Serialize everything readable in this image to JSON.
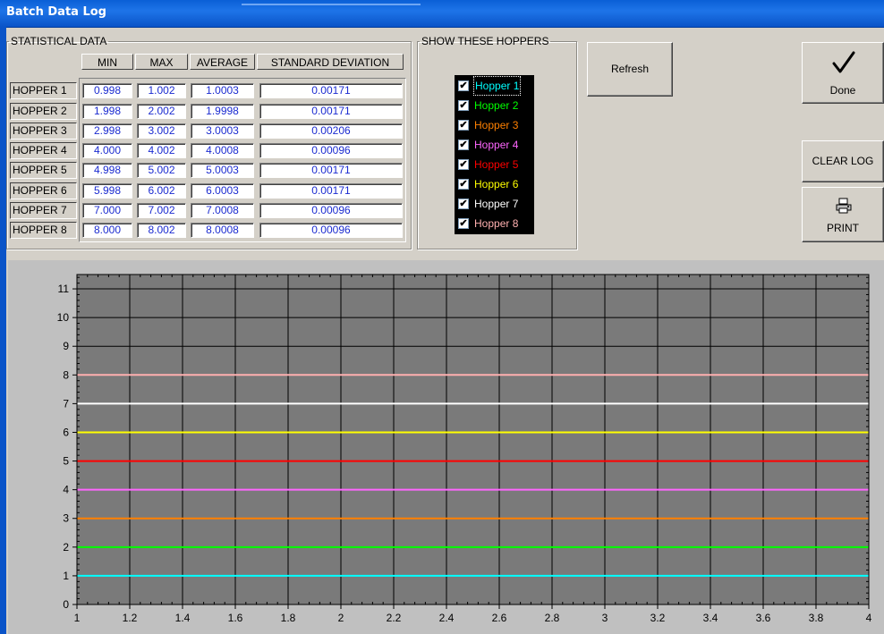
{
  "window": {
    "title": "Batch Data Log"
  },
  "stats": {
    "legend": "STATISTICAL DATA",
    "columns": [
      "MIN",
      "MAX",
      "AVERAGE",
      "STANDARD DEVIATION"
    ],
    "rows": [
      {
        "label": "HOPPER 1",
        "min": "0.998",
        "max": "1.002",
        "average": "1.0003",
        "stddev": "0.00171"
      },
      {
        "label": "HOPPER 2",
        "min": "1.998",
        "max": "2.002",
        "average": "1.9998",
        "stddev": "0.00171"
      },
      {
        "label": "HOPPER 3",
        "min": "2.998",
        "max": "3.002",
        "average": "3.0003",
        "stddev": "0.00206"
      },
      {
        "label": "HOPPER 4",
        "min": "4.000",
        "max": "4.002",
        "average": "4.0008",
        "stddev": "0.00096"
      },
      {
        "label": "HOPPER 5",
        "min": "4.998",
        "max": "5.002",
        "average": "5.0003",
        "stddev": "0.00171"
      },
      {
        "label": "HOPPER 6",
        "min": "5.998",
        "max": "6.002",
        "average": "6.0003",
        "stddev": "0.00171"
      },
      {
        "label": "HOPPER 7",
        "min": "7.000",
        "max": "7.002",
        "average": "7.0008",
        "stddev": "0.00096"
      },
      {
        "label": "HOPPER 8",
        "min": "8.000",
        "max": "8.002",
        "average": "8.0008",
        "stddev": "0.00096"
      }
    ]
  },
  "hoppers": {
    "legend": "SHOW THESE HOPPERS",
    "items": [
      {
        "label": "Hopper 1",
        "checked": true,
        "color": "#00ffff"
      },
      {
        "label": "Hopper 2",
        "checked": true,
        "color": "#00ff00"
      },
      {
        "label": "Hopper 3",
        "checked": true,
        "color": "#ff8000"
      },
      {
        "label": "Hopper 4",
        "checked": true,
        "color": "#ff66ff"
      },
      {
        "label": "Hopper 5",
        "checked": true,
        "color": "#ff0000"
      },
      {
        "label": "Hopper 6",
        "checked": true,
        "color": "#ffff00"
      },
      {
        "label": "Hopper 7",
        "checked": true,
        "color": "#ffffff"
      },
      {
        "label": "Hopper 8",
        "checked": true,
        "color": "#ffb0b0"
      }
    ]
  },
  "buttons": {
    "refresh": "Refresh",
    "done": "Done",
    "clear_log": "CLEAR LOG",
    "print": "PRINT"
  },
  "chart_data": {
    "type": "line",
    "xlim": [
      1,
      4
    ],
    "ylim": [
      0,
      11.5
    ],
    "x_ticks": [
      "1",
      "1.2",
      "1.4",
      "1.6",
      "1.8",
      "2",
      "2.2",
      "2.4",
      "2.6",
      "2.8",
      "3",
      "3.2",
      "3.4",
      "3.6",
      "3.8",
      "4"
    ],
    "y_ticks": [
      "0",
      "1",
      "2",
      "3",
      "4",
      "5",
      "6",
      "7",
      "8",
      "9",
      "10",
      "11"
    ],
    "grid": true,
    "background": "#7a7a7a",
    "series": [
      {
        "name": "Hopper 1",
        "color": "#00ffff",
        "x": [
          1,
          4
        ],
        "y": [
          1,
          1
        ]
      },
      {
        "name": "Hopper 2",
        "color": "#00ff00",
        "x": [
          1,
          4
        ],
        "y": [
          2,
          2
        ]
      },
      {
        "name": "Hopper 3",
        "color": "#ff8000",
        "x": [
          1,
          4
        ],
        "y": [
          3,
          3
        ]
      },
      {
        "name": "Hopper 4",
        "color": "#ff66ff",
        "x": [
          1,
          4
        ],
        "y": [
          4,
          4
        ]
      },
      {
        "name": "Hopper 5",
        "color": "#ff0000",
        "x": [
          1,
          4
        ],
        "y": [
          5,
          5
        ]
      },
      {
        "name": "Hopper 6",
        "color": "#ffff00",
        "x": [
          1,
          4
        ],
        "y": [
          6,
          6
        ]
      },
      {
        "name": "Hopper 7",
        "color": "#ffffff",
        "x": [
          1,
          4
        ],
        "y": [
          7,
          7
        ]
      },
      {
        "name": "Hopper 8",
        "color": "#ffb0b0",
        "x": [
          1,
          4
        ],
        "y": [
          8,
          8
        ]
      }
    ]
  }
}
